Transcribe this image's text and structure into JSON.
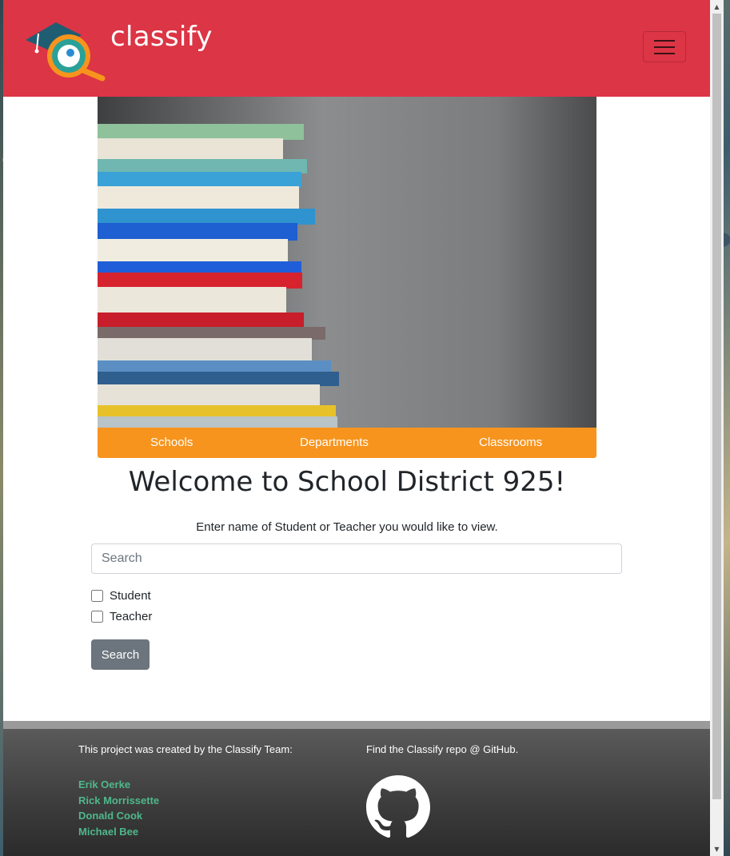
{
  "header": {
    "brand": "classify",
    "logo_icon": "graduation-cap-magnifier-icon",
    "menu_icon": "hamburger-icon"
  },
  "hero": {
    "image": "stacked-books-photo"
  },
  "subnav": {
    "items": [
      "Schools",
      "Departments",
      "Classrooms"
    ]
  },
  "main": {
    "welcome": "Welcome to School District 925!",
    "prompt": "Enter name of Student or Teacher you would like to view.",
    "search": {
      "placeholder": "Search",
      "value": ""
    },
    "filters": [
      {
        "label": "Student",
        "checked": false
      },
      {
        "label": "Teacher",
        "checked": false
      }
    ],
    "search_button": "Search"
  },
  "footer": {
    "credit": "This project was created by the Classify Team:",
    "team": [
      "Erik Oerke",
      "Rick Morrissette",
      "Donald Cook",
      "Michael Bee"
    ],
    "repo": "Find the Classify repo @ GitHub.",
    "repo_icon": "github-icon"
  },
  "colors": {
    "header": "#dc3545",
    "subnav": "#f7941d",
    "button": "#6c757d",
    "team_link": "#4fb88b"
  }
}
